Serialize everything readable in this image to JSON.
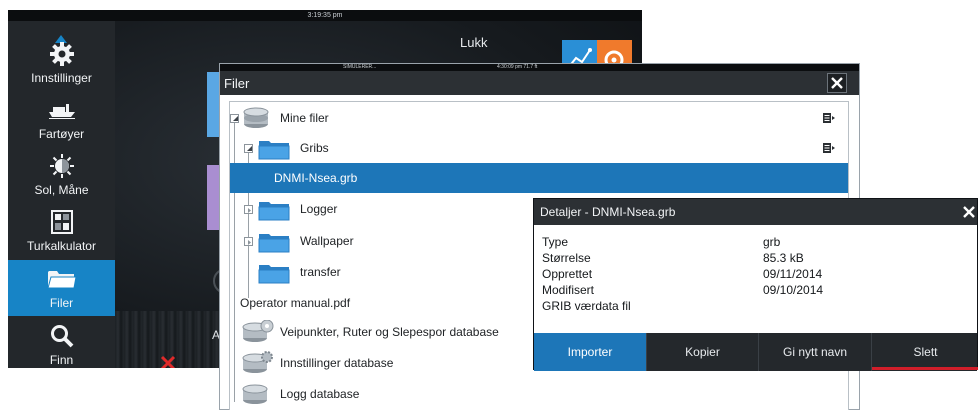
{
  "back_screen": {
    "clock": "3:19:35 pm",
    "close_label": "Lukk",
    "partial_label": "Au",
    "sidebar": {
      "items": [
        {
          "label": "Innstillinger",
          "icon": "gear-icon"
        },
        {
          "label": "Fartøyer",
          "icon": "vessel-icon"
        },
        {
          "label": "Sol, Måne",
          "icon": "sun-moon-icon"
        },
        {
          "label": "Turkalkulator",
          "icon": "calculator-icon"
        },
        {
          "label": "Filer",
          "icon": "folder-icon",
          "active": true
        },
        {
          "label": "Finn",
          "icon": "search-icon"
        }
      ]
    },
    "accent": "#1784c6"
  },
  "files_window": {
    "status_left": "SIMULERER...",
    "status_right": "4:30:09 pm   71.7 ft",
    "title": "Filer",
    "rows": [
      {
        "label": "Mine filer",
        "icon": "database-icon"
      },
      {
        "label": "Gribs",
        "icon": "folder-icon"
      },
      {
        "label": "DNMI-Nsea.grb",
        "icon": "none",
        "selected": true
      },
      {
        "label": "Logger",
        "icon": "folder-icon"
      },
      {
        "label": "Wallpaper",
        "icon": "folder-icon"
      },
      {
        "label": "transfer",
        "icon": "folder-icon"
      },
      {
        "label": "Operator manual.pdf",
        "icon": "none"
      },
      {
        "label": "Veipunkter, Ruter og Slepespor database",
        "icon": "database-icon"
      },
      {
        "label": "Innstillinger database",
        "icon": "database-icon"
      },
      {
        "label": "Logg database",
        "icon": "database-icon"
      }
    ],
    "selection_color": "#1d76b8"
  },
  "details": {
    "title": "Detaljer - DNMI-Nsea.grb",
    "properties": [
      {
        "key": "Type",
        "value": "grb"
      },
      {
        "key": "Størrelse",
        "value": "85.3 kB"
      },
      {
        "key": "Opprettet",
        "value": "09/11/2014"
      },
      {
        "key": "Modifisert",
        "value": "09/10/2014"
      },
      {
        "key": "GRIB værdata fil",
        "value": ""
      }
    ],
    "buttons": {
      "import": "Importer",
      "copy": "Kopier",
      "rename": "Gi nytt navn",
      "delete": "Slett"
    },
    "delete_color": "#d11e2a"
  }
}
